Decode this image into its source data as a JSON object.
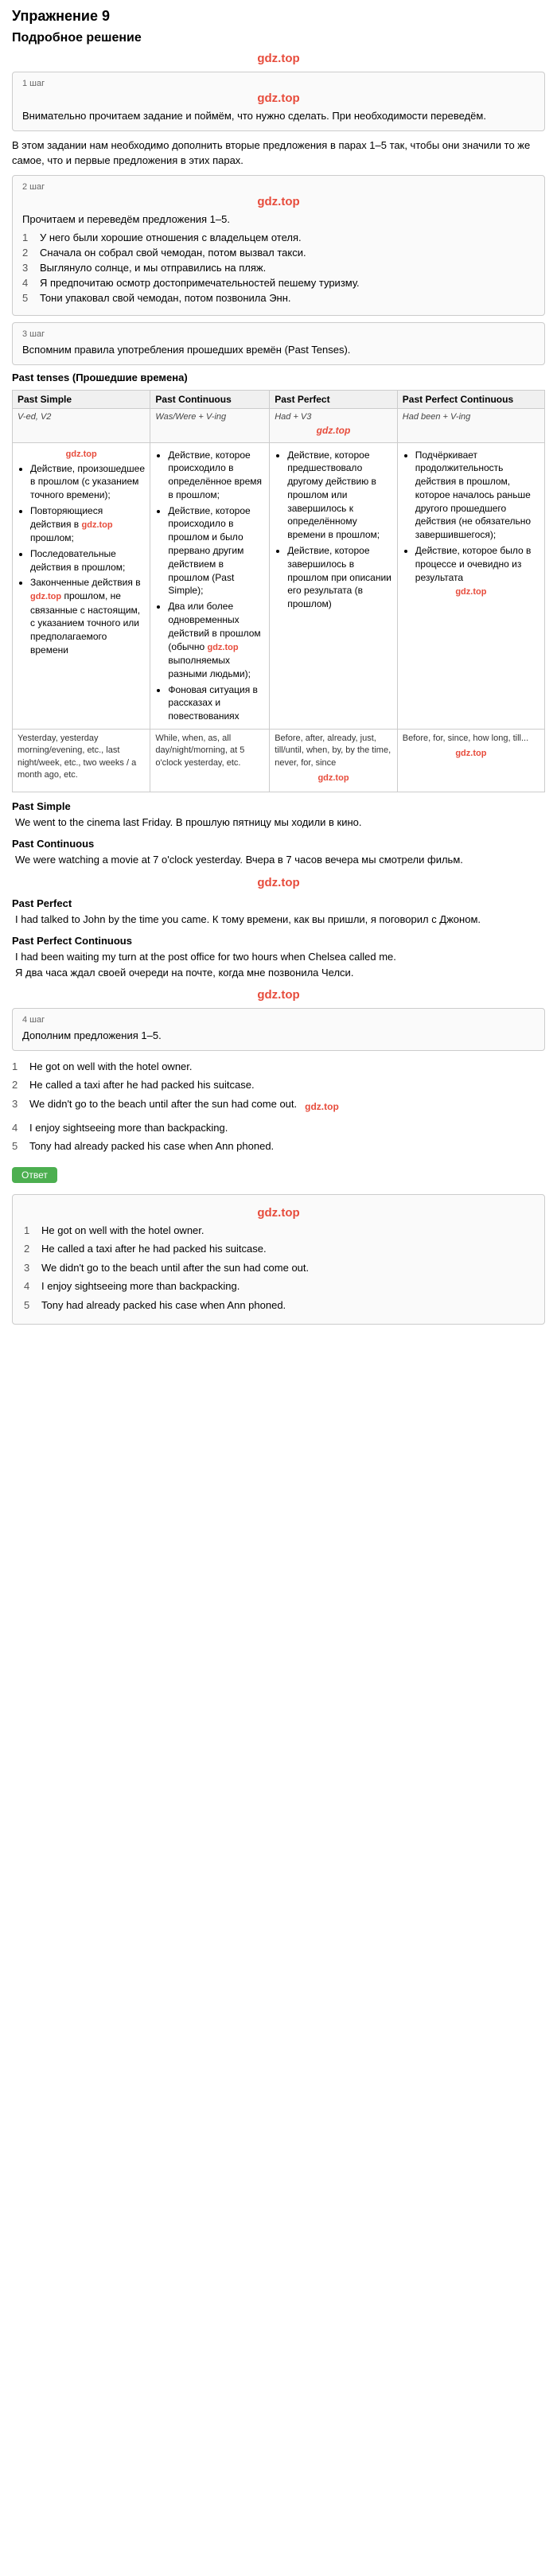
{
  "page": {
    "title": "Упражнение 9",
    "subtitle": "Подробное решение"
  },
  "watermark": "gdz.top",
  "steps": [
    {
      "label": "1 шаг",
      "watermark": "gdz.top",
      "text": "Внимательно прочитаем задание и поймём, что нужно сделать. При необходимости переведём."
    },
    {
      "label": "2 шаг",
      "intro": "В этом задании нам необходимо дополнить вторые предложения в парах 1–5 так, чтобы они значили то же самое, что и первые предложения в этих парах."
    },
    {
      "label": "2 шаг",
      "text": "Прочитаем и переведём предложения 1–5.",
      "sentences": [
        "У него были хорошие отношения с владельцем отеля.",
        "Сначала он собрал свой чемодан, потом вызвал такси.",
        "Выглянуло солнце, и мы отправились на пляж.",
        "Я предпочитаю осмотр достопримечательностей пешему туризму.",
        "Тони упаковал свой чемодан, потом позвонила Энн."
      ]
    },
    {
      "label": "3 шаг",
      "text": "Вспомним правила употребления прошедших времён (Past Tenses)."
    }
  ],
  "tenses_title": "Past tenses (Прошедшие времена)",
  "tenses": {
    "headers": [
      "Past Simple",
      "Past Continuous",
      "Past Perfect",
      "Past Perfect Continuous"
    ],
    "formulas": [
      "V-ed, V2",
      "Was/Were + V-ing",
      "Had + V3",
      "Had been + V-ing"
    ],
    "past_simple": {
      "uses": [
        "Действие, произошедшее в прошлом (с указанием точного времени);",
        "Повторяющиеся действия в прошлом;",
        "Последовательные действия в прошлом;",
        "Законченные действия в прошлом, не связанные с настоящим, с указанием точного или предполагаемого времени"
      ]
    },
    "past_continuous": {
      "uses": [
        "Действие, которое происходило в определённое время в прошлом;",
        "Действие, которое происходило в прошлом и было прервано другим действием в прошлом (Past Simple);",
        "Два или более одновременных действий в прошлом (обычно выполняемых разными людьми);",
        "Фоновая ситуация в рассказах и повествованиях"
      ]
    },
    "past_perfect": {
      "uses": [
        "Действие, которое предшествовало другому действию в прошлом или завершилось к определённому времени в прошлом;",
        "Действие, которое завершилось в прошлом при описании его результата (в прошлом)"
      ]
    },
    "past_perfect_continuous": {
      "uses": [
        "Подчёркивает продолжительность действия в прошлом, которое началось раньше другого прошедшего действия (не обязательно завершившегося);",
        "Действие, которое было в процессе и очевидно из результата"
      ]
    },
    "time_words": {
      "past_simple": "Yesterday, yesterday morning/evening, etc., last night/week, etc., two weeks / a month ago, etc.",
      "past_continuous": "While, when, as, all day/night/morning, at 5 o'clock yesterday, etc.",
      "past_perfect": "Before, after, already, just, till/until, when, by, by the time, never, for, since",
      "past_perfect_continuous": "Before, for, since, how long, till..."
    }
  },
  "tense_examples": [
    {
      "title": "Past Simple",
      "en": "We went to the cinema last Friday.",
      "ru": "В прошлую пятницу мы ходили в кино."
    },
    {
      "title": "Past Continuous",
      "en": "We were watching a movie at 7 o'clock yesterday.",
      "ru": "Вчера в 7 часов вечера мы смотрели фильм."
    },
    {
      "title": "Past Perfect",
      "en": "I had talked to John by the time you came.",
      "ru": "К тому времени, как вы пришли, я поговорил с Джоном."
    },
    {
      "title": "Past Perfect Continuous",
      "en": "I had been waiting my turn at the post office for two hours when Chelsea called me.",
      "ru": "Я два часа ждал своей очереди на почте, когда мне позвонила Челси."
    }
  ],
  "step4": {
    "label": "4 шаг",
    "text": "Дополним предложения 1–5."
  },
  "answers": [
    "He got on well with the hotel owner.",
    "He called a taxi after he had packed his suitcase.",
    "We didn't go to the beach until after the sun had come out.",
    "I enjoy sightseeing more than backpacking.",
    "Tony had already packed his case when Ann phoned."
  ],
  "answer_btn": "Ответ",
  "final_answers": [
    "He got on well with the hotel owner.",
    "He called a taxi after he had packed his suitcase.",
    "We didn't go to the beach until after the sun had come out.",
    "I enjoy sightseeing more than backpacking.",
    "Tony had already packed his case when Ann phoned."
  ]
}
